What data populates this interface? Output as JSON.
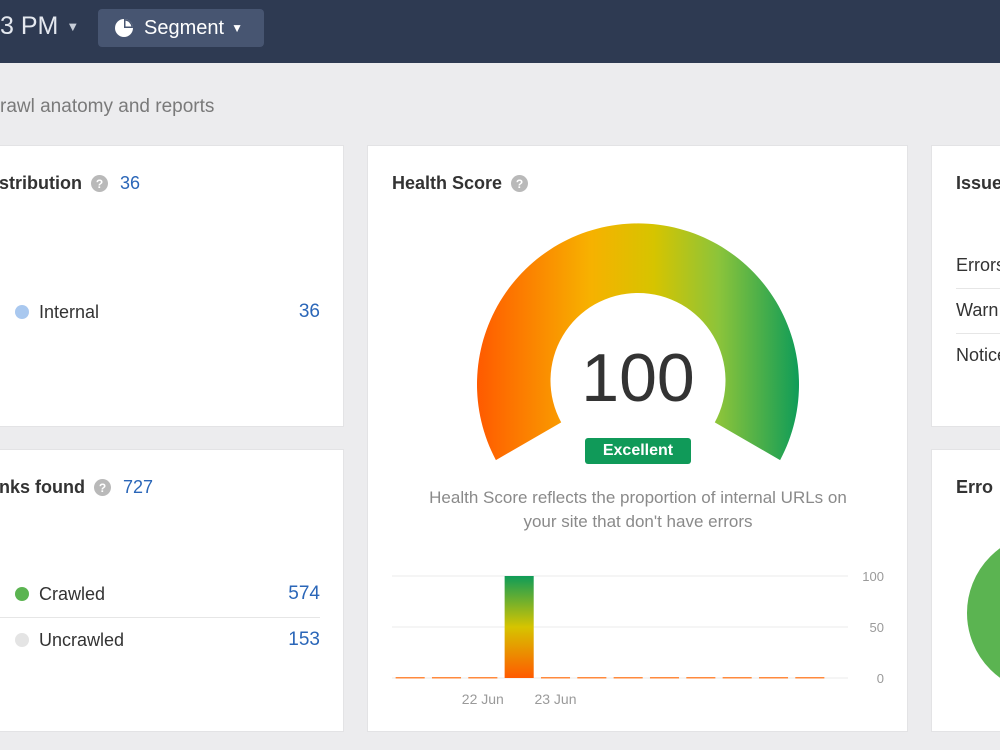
{
  "header": {
    "time_text": "3 PM",
    "segment_label": "Segment"
  },
  "subtitle": "rawl anatomy and reports",
  "distribution_card": {
    "title": "stribution",
    "count": "36",
    "rows": [
      {
        "label": "Internal",
        "value": "36",
        "dot_color": "#a9c8ef"
      }
    ]
  },
  "links_card": {
    "title": "nks found",
    "count": "727",
    "rows": [
      {
        "label": "Crawled",
        "value": "574",
        "dot_color": "#5bb451"
      },
      {
        "label": "Uncrawled",
        "value": "153",
        "dot_color": "#e4e4e4"
      }
    ]
  },
  "health_card": {
    "title": "Health Score",
    "score": "100",
    "rating": "Excellent",
    "rating_color": "#109a59",
    "description_line1": "Health Score reflects the proportion of internal URLs on",
    "description_line2": "your site that don't have errors"
  },
  "issues_card": {
    "title": "Issue",
    "rows": [
      "Errors",
      "Warn",
      "Notice"
    ]
  },
  "errors_card": {
    "title": "Erro",
    "donut_color": "#5bb451"
  },
  "chart_data": {
    "type": "bar",
    "categories": [
      "",
      "",
      "22 Jun",
      "",
      "23 Jun",
      "",
      "",
      "",
      "",
      "",
      "",
      ""
    ],
    "values": [
      0,
      0,
      0,
      100,
      0,
      0,
      0,
      0,
      0,
      0,
      0,
      0
    ],
    "x_tick_labels": [
      "22 Jun",
      "23 Jun"
    ],
    "y_ticks": [
      0,
      50,
      100
    ],
    "ylim": [
      0,
      100
    ],
    "grid": true
  }
}
